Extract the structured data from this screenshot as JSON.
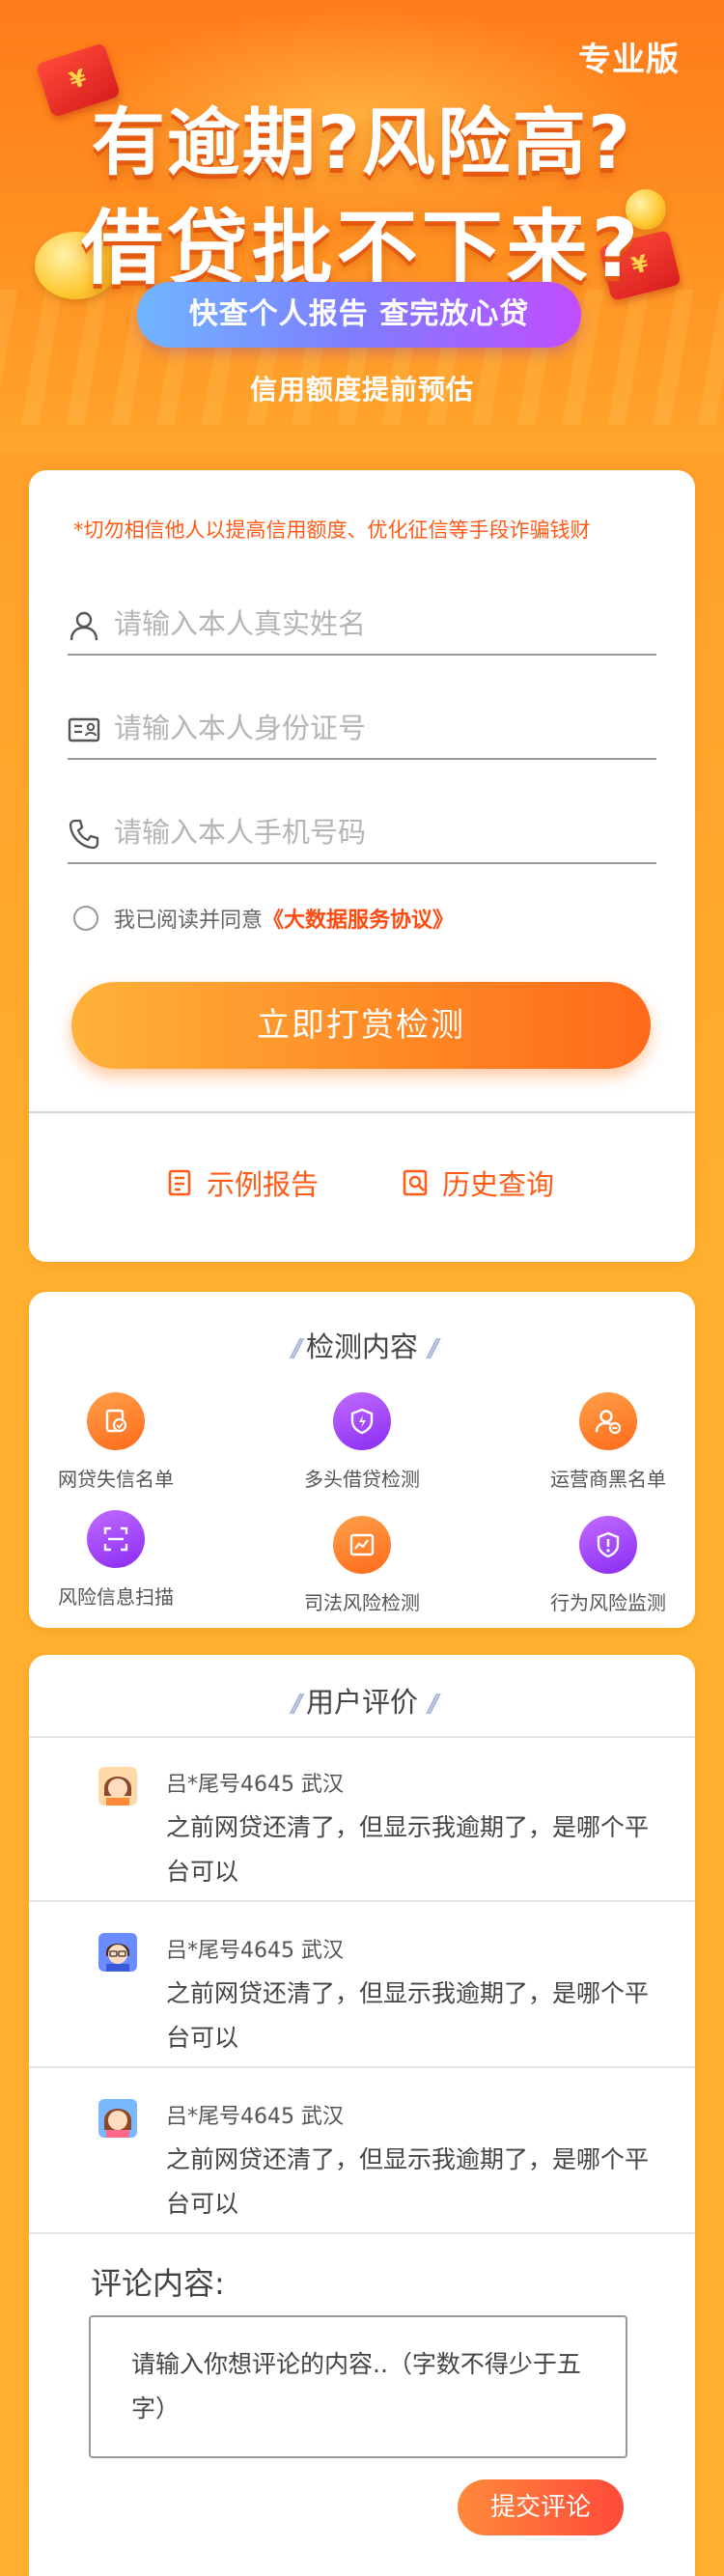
{
  "hero": {
    "badge": "专业版",
    "headline_1": "有逾期?风险高?",
    "headline_2": "借贷批不下来?",
    "pill": "快查个人报告  查完放心贷",
    "subtitle": "信用额度提前预估"
  },
  "form": {
    "warning": "*切勿相信他人以提高信用额度、优化征信等手段诈骗钱财",
    "name_placeholder": "请输入本人真实姓名",
    "id_placeholder": "请输入本人身份证号",
    "phone_placeholder": "请输入本人手机号码",
    "agree_prefix": "我已阅读并同意",
    "agree_link": "《大数据服务协议》",
    "submit_label": "立即打赏检测",
    "sample_report": "示例报告",
    "history_query": "历史查询"
  },
  "detect": {
    "title": "检测内容",
    "items": [
      {
        "label": "网贷失信名单",
        "icon": "document-check-icon",
        "color": "orange"
      },
      {
        "label": "多头借贷检测",
        "icon": "shield-lightning-icon",
        "color": "purple"
      },
      {
        "label": "运营商黑名单",
        "icon": "user-minus-icon",
        "color": "orange"
      },
      {
        "label": "风险信息扫描",
        "icon": "scan-icon",
        "color": "purple"
      },
      {
        "label": "司法风险检测",
        "icon": "chart-monitor-icon",
        "color": "orange"
      },
      {
        "label": "行为风险监测",
        "icon": "shield-alert-icon",
        "color": "purple"
      }
    ]
  },
  "reviews": {
    "title": "用户评价",
    "items": [
      {
        "user": "吕*尾号4645  武汉",
        "text": "之前网贷还清了，但显示我逾期了，是哪个平台可以"
      },
      {
        "user": "吕*尾号4645  武汉",
        "text": "之前网贷还清了，但显示我逾期了，是哪个平台可以"
      },
      {
        "user": "吕*尾号4645  武汉",
        "text": "之前网贷还清了，但显示我逾期了，是哪个平台可以"
      }
    ],
    "comment_label": "评论内容:",
    "comment_placeholder": "请输入你想评论的内容..（字数不得少于五字）",
    "submit_label": "提交评论"
  },
  "colors": {
    "accent": "#ff5a16",
    "orange_gradient_start": "#ffb23a",
    "orange_gradient_end": "#ff6a1a",
    "purple": "#8a2cf2"
  }
}
